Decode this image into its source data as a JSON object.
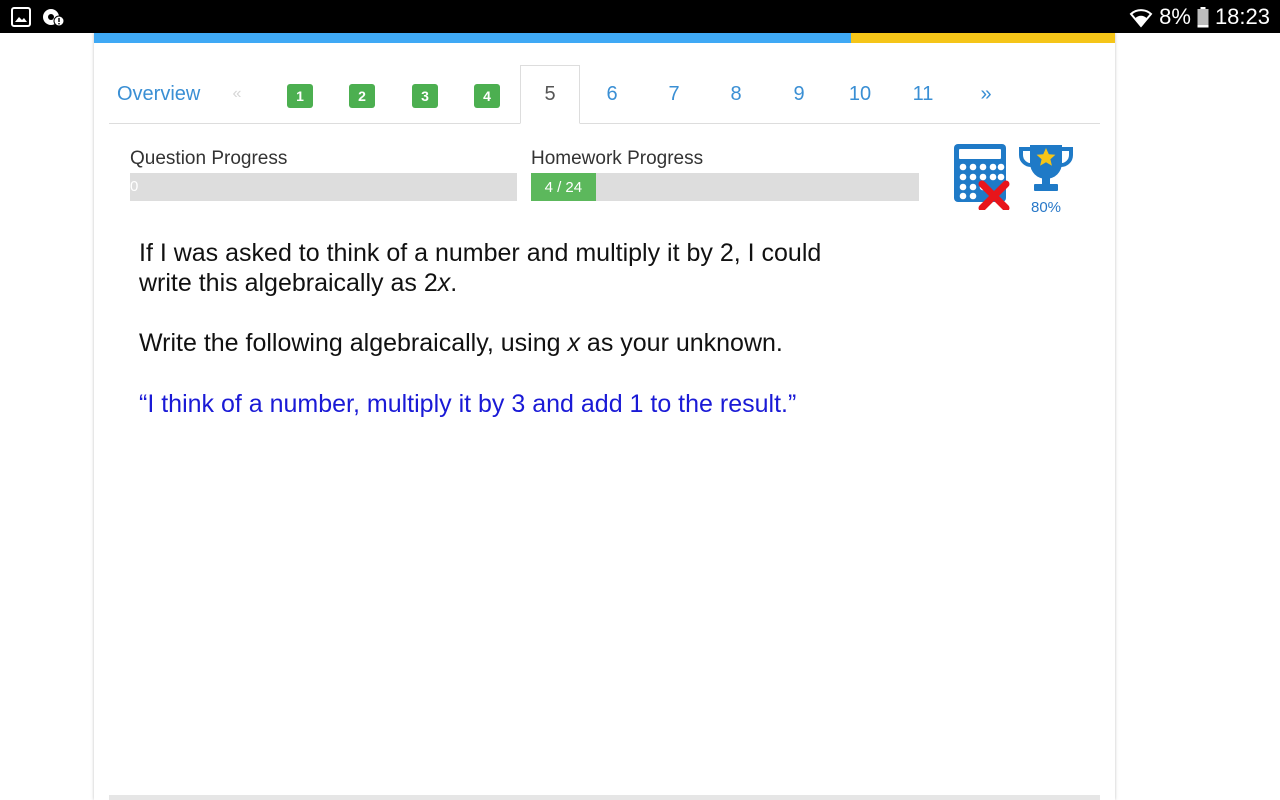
{
  "status_bar": {
    "battery_percent": "8%",
    "time": "18:23",
    "icons": [
      "gallery-icon",
      "notification-icon",
      "wifi-icon",
      "battery-icon"
    ]
  },
  "nav": {
    "overview_label": "Overview",
    "prev_label": "«",
    "completed": [
      "1",
      "2",
      "3",
      "4"
    ],
    "current": "5",
    "upcoming": [
      "6",
      "7",
      "8",
      "9",
      "10",
      "11"
    ],
    "next_label": "»"
  },
  "progress": {
    "question_label": "Question Progress",
    "question_value": "0",
    "question_fraction": 0,
    "homework_label": "Homework Progress",
    "homework_value": "4 / 24",
    "homework_fraction": 0.1667
  },
  "score": {
    "trophy_percent": "80%",
    "calculator_allowed": false
  },
  "question": {
    "intro_line1": "If I was asked to think of a number and multiply it by 2, I could",
    "intro_line2_prefix": "write this algebraically as 2",
    "intro_line2_var": "x",
    "intro_line2_suffix": ".",
    "instruction_prefix": "Write the following algebraically, using ",
    "instruction_var": "x",
    "instruction_suffix": " as your unknown.",
    "quote": "“I think of a number, multiply it by 3 and add 1 to the result.”"
  },
  "colors": {
    "accent_blue": "#3a8fd4",
    "strip_blue": "#3fa9f5",
    "strip_yellow": "#f5c518",
    "success_green": "#5cb85c",
    "quote_blue": "#1a1ad6"
  }
}
